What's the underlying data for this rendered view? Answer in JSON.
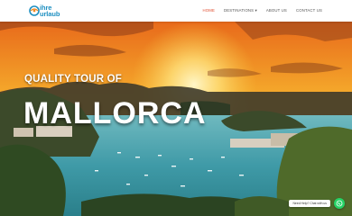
{
  "brand": {
    "line1": "ihre",
    "line2": "urlaub",
    "accent": "#1d8fc1"
  },
  "nav": {
    "items": [
      {
        "label": "HOME",
        "active": true
      },
      {
        "label": "DESTINATIONS ▾",
        "active": false
      },
      {
        "label": "ABOUT US",
        "active": false
      },
      {
        "label": "CONTACT US",
        "active": false
      }
    ],
    "active_color": "#e04a2b"
  },
  "hero": {
    "subtitle": "QUALITY TOUR OF",
    "title": "MALLORCA"
  },
  "chat": {
    "label": "Need Help? Chat with us",
    "icon": "whatsapp-icon",
    "color": "#25d366"
  }
}
